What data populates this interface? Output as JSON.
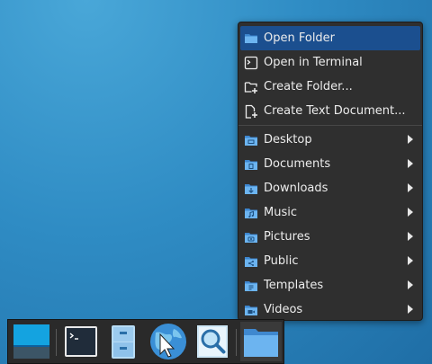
{
  "menu": {
    "items": [
      {
        "label": "Open Folder",
        "icon": "folder-icon",
        "submenu": false
      },
      {
        "label": "Open in Terminal",
        "icon": "terminal-icon",
        "submenu": false
      },
      {
        "label": "Create Folder...",
        "icon": "new-folder-icon",
        "submenu": false
      },
      {
        "label": "Create Text Document...",
        "icon": "new-document-icon",
        "submenu": false
      },
      {
        "label": "Desktop",
        "icon": "desktop-folder-icon",
        "submenu": true
      },
      {
        "label": "Documents",
        "icon": "documents-folder-icon",
        "submenu": true
      },
      {
        "label": "Downloads",
        "icon": "downloads-folder-icon",
        "submenu": true
      },
      {
        "label": "Music",
        "icon": "music-folder-icon",
        "submenu": true
      },
      {
        "label": "Pictures",
        "icon": "pictures-folder-icon",
        "submenu": true
      },
      {
        "label": "Public",
        "icon": "public-folder-icon",
        "submenu": true
      },
      {
        "label": "Templates",
        "icon": "templates-folder-icon",
        "submenu": true
      },
      {
        "label": "Videos",
        "icon": "videos-folder-icon",
        "submenu": true
      }
    ]
  },
  "taskbar": {
    "items": [
      "show-desktop-icon",
      "terminal-icon",
      "file-cabinet-icon",
      "web-browser-icon",
      "search-icon",
      "folder-icon"
    ]
  },
  "colors": {
    "desktop_bg": "#2f8cc4",
    "menu_bg": "#2f2f2f",
    "menu_highlight": "#1b4f8f",
    "folder_blue": "#5aa7e8"
  }
}
